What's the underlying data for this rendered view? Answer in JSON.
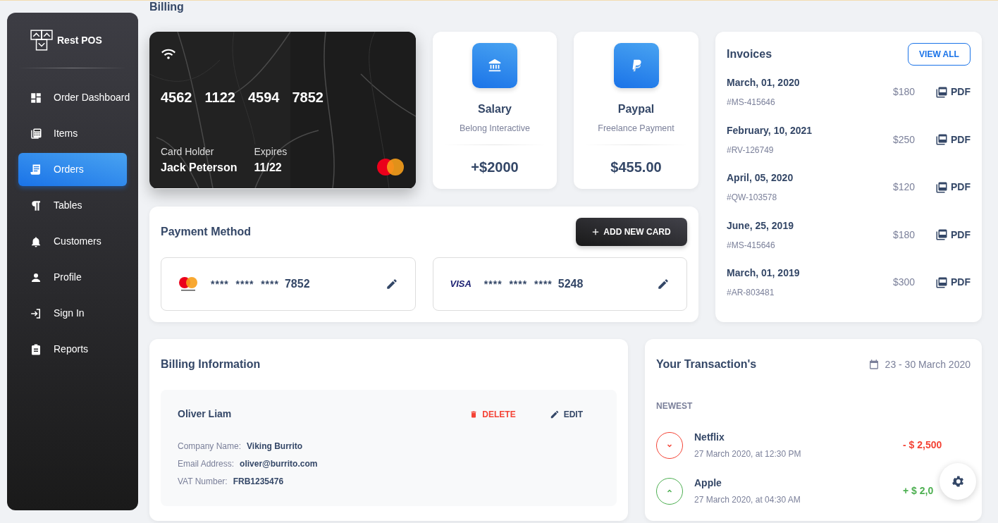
{
  "page_title": "Billing",
  "sidebar": {
    "brand": "Rest POS",
    "items": [
      {
        "label": "Order Dashboard",
        "selected": false
      },
      {
        "label": "Items",
        "selected": false
      },
      {
        "label": "Orders",
        "selected": true
      },
      {
        "label": "Tables",
        "selected": false
      },
      {
        "label": "Customers",
        "selected": false
      },
      {
        "label": "Profile",
        "selected": false
      },
      {
        "label": "Sign In",
        "selected": false
      },
      {
        "label": "Reports",
        "selected": false
      }
    ]
  },
  "credit_card": {
    "number_groups": [
      "4562",
      "1122",
      "4594",
      "7852"
    ],
    "holder_label": "Card Holder",
    "holder": "Jack Peterson",
    "expires_label": "Expires",
    "expires": "11/22"
  },
  "stat_cards": [
    {
      "title": "Salary",
      "subtitle": "Belong Interactive",
      "amount": "+$2000"
    },
    {
      "title": "Paypal",
      "subtitle": "Freelance Payment",
      "amount": "$455.00"
    }
  ],
  "payment_method": {
    "title": "Payment Method",
    "add_button": "ADD NEW CARD",
    "cards": [
      {
        "kind": "mastercard",
        "masked": "****  ****  ****",
        "last4": "7852"
      },
      {
        "kind": "visa",
        "brand": "VISA",
        "masked": "****  ****  ****",
        "last4": "5248"
      }
    ]
  },
  "invoices": {
    "title": "Invoices",
    "view_all": "VIEW ALL",
    "items": [
      {
        "date": "March, 01, 2020",
        "code": "#MS-415646",
        "amount": "$180",
        "download": "PDF"
      },
      {
        "date": "February, 10, 2021",
        "code": "#RV-126749",
        "amount": "$250",
        "download": "PDF"
      },
      {
        "date": "April, 05, 2020",
        "code": "#QW-103578",
        "amount": "$120",
        "download": "PDF"
      },
      {
        "date": "June, 25, 2019",
        "code": "#MS-415646",
        "amount": "$180",
        "download": "PDF"
      },
      {
        "date": "March, 01, 2019",
        "code": "#AR-803481",
        "amount": "$300",
        "download": "PDF"
      }
    ]
  },
  "billing_info": {
    "title": "Billing Information",
    "entries": [
      {
        "name": "Oliver Liam",
        "delete": "DELETE",
        "edit": "EDIT",
        "fields": [
          {
            "label": "Company Name:",
            "value": "Viking Burrito"
          },
          {
            "label": "Email Address:",
            "value": "oliver@burrito.com"
          },
          {
            "label": "VAT Number:",
            "value": "FRB1235476"
          }
        ]
      }
    ]
  },
  "transactions": {
    "title": "Your Transaction's",
    "date_range": "23 - 30 March 2020",
    "group_label": "NEWEST",
    "items": [
      {
        "kind": "expense",
        "name": "Netflix",
        "time": "27 March 2020, at 12:30 PM",
        "amount": "- $ 2,500"
      },
      {
        "kind": "income",
        "name": "Apple",
        "time": "27 March 2020, at 04:30 AM",
        "amount": "+ $ 2,0"
      }
    ]
  }
}
